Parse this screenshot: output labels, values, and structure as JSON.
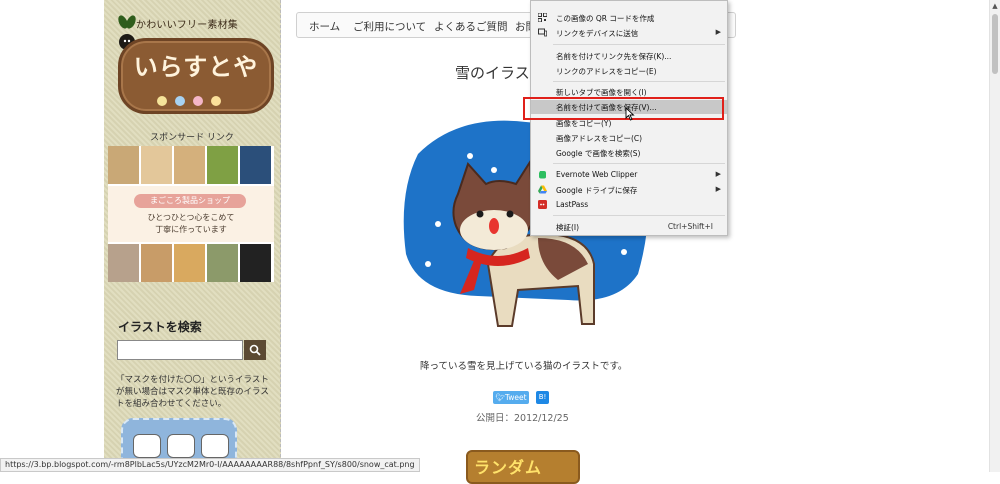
{
  "sidebar": {
    "logo_tagline": "かわいいフリー素材集",
    "logo_title": "いらすとや",
    "sponsor_label": "スポンサード リンク",
    "ad": {
      "shop_name": "まごころ製品ショップ",
      "line1": "ひとつひとつ心をこめて",
      "line2": "丁寧に作っています"
    },
    "search_title": "イラストを検索",
    "search_placeholder": "",
    "search_note": "「マスクを付けた〇〇」というイラストが無い場合はマスク単体と既存のイラストを組み合わせてください。"
  },
  "nav": {
    "items": [
      "ホーム",
      "ご利用について",
      "よくあるご質問",
      "お問"
    ]
  },
  "post": {
    "title": "雪のイラスト",
    "caption": "降っている雪を見上げている猫のイラストです。",
    "tweet_label": "Tweet",
    "hatena_label": "B!",
    "date": "公開日：2012/12/25",
    "random_label": "ランダム"
  },
  "context_menu": {
    "items": [
      {
        "label": "この画像の QR コードを作成",
        "icon": "qr-icon"
      },
      {
        "label": "リンクをデバイスに送信",
        "icon": "device-icon",
        "submenu": true
      },
      {
        "label": "名前を付けてリンク先を保存(K)..."
      },
      {
        "label": "リンクのアドレスをコピー(E)"
      },
      {
        "label": "新しいタブで画像を開く(I)"
      },
      {
        "label": "名前を付けて画像を保存(V)...",
        "highlighted": true
      },
      {
        "label": "画像をコピー(Y)"
      },
      {
        "label": "画像アドレスをコピー(C)"
      },
      {
        "label": "Google で画像を検索(S)"
      },
      {
        "label": "Evernote Web Clipper",
        "icon": "evernote-icon",
        "submenu": true
      },
      {
        "label": "Google ドライブに保存",
        "icon": "google-drive-icon",
        "submenu": true
      },
      {
        "label": "LastPass",
        "icon": "lastpass-icon"
      },
      {
        "label": "検証(I)",
        "shortcut": "Ctrl+Shift+I"
      }
    ]
  },
  "status_bar": {
    "url": "https://3.bp.blogspot.com/-rm8PlbLac5s/UYzcM2Mr0-I/AAAAAAAAR88/8shfPpnf_SY/s800/snow_cat.png"
  },
  "colors": {
    "sidebar_bg": "#ddd9b7",
    "highlight_border": "#e0201a",
    "menu_hover": "#c8c8c8",
    "illustration_blue": "#1e73c8",
    "tweet_blue": "#55acee"
  }
}
